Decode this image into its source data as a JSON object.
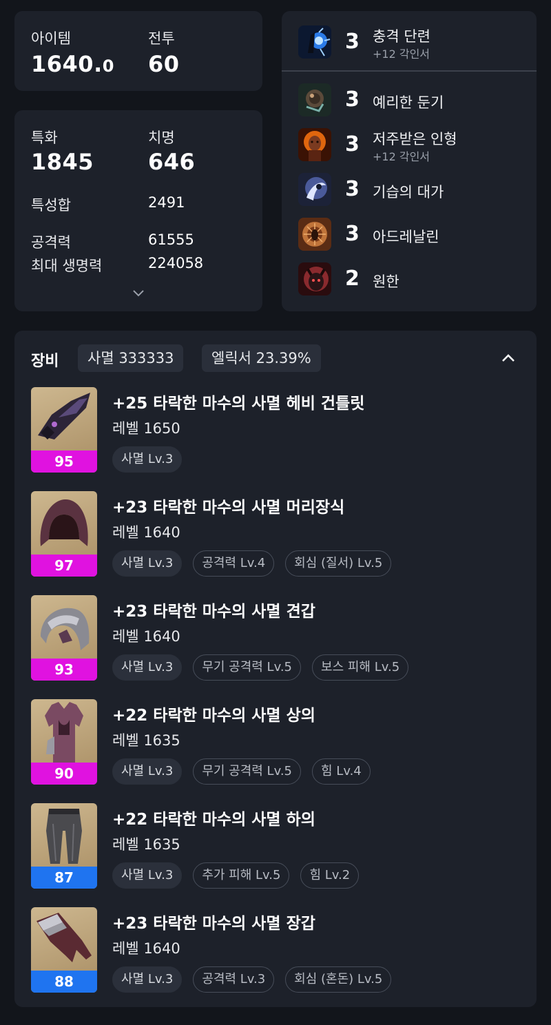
{
  "stats_top": {
    "item_label": "아이템",
    "item_value_main": "1640.",
    "item_value_decimal": "0",
    "combat_label": "전투",
    "combat_value": "60"
  },
  "stats_detail": {
    "spec_label": "특화",
    "spec_value": "1845",
    "crit_label": "치명",
    "crit_value": "646",
    "sum_label": "특성합",
    "sum_value": "2491",
    "atk_label": "공격력",
    "atk_value": "61555",
    "hp_label": "최대 생명력",
    "hp_value": "224058",
    "expand_icon": "chevron-down-icon"
  },
  "engravings": [
    {
      "level": "3",
      "name": "충격 단련",
      "sub": "+12 각인서",
      "icon": "shock-engraving-icon"
    },
    {
      "level": "3",
      "name": "예리한 둔기",
      "sub": "",
      "icon": "keen-blunt-engraving-icon"
    },
    {
      "level": "3",
      "name": "저주받은 인형",
      "sub": "+12 각인서",
      "icon": "cursed-doll-engraving-icon"
    },
    {
      "level": "3",
      "name": "기습의 대가",
      "sub": "",
      "icon": "master-ambush-engraving-icon"
    },
    {
      "level": "3",
      "name": "아드레날린",
      "sub": "",
      "icon": "adrenaline-engraving-icon"
    },
    {
      "level": "2",
      "name": "원한",
      "sub": "",
      "icon": "grudge-engraving-icon"
    }
  ],
  "equipment": {
    "title": "장비",
    "badge_set": "사멸 333333",
    "badge_elixir": "엘릭서 23.39%",
    "collapse_icon": "chevron-up-icon",
    "items": [
      {
        "name": "+25 타락한 마수의 사멸 헤비 건틀릿",
        "level": "레벨 1650",
        "quality": "95",
        "quality_color": "#e012e0",
        "icon": "gauntlet-icon",
        "tags": [
          "사멸 Lv.3"
        ]
      },
      {
        "name": "+23 타락한 마수의 사멸 머리장식",
        "level": "레벨 1640",
        "quality": "97",
        "quality_color": "#e012e0",
        "icon": "hood-icon",
        "tags": [
          "사멸 Lv.3",
          "공격력 Lv.4",
          "회심 (질서) Lv.5"
        ]
      },
      {
        "name": "+23 타락한 마수의 사멸 견갑",
        "level": "레벨 1640",
        "quality": "93",
        "quality_color": "#e012e0",
        "icon": "pauldron-icon",
        "tags": [
          "사멸 Lv.3",
          "무기 공격력 Lv.5",
          "보스 피해 Lv.5"
        ]
      },
      {
        "name": "+22 타락한 마수의 사멸 상의",
        "level": "레벨 1635",
        "quality": "90",
        "quality_color": "#e012e0",
        "icon": "chest-armor-icon",
        "tags": [
          "사멸 Lv.3",
          "무기 공격력 Lv.5",
          "힘 Lv.4"
        ]
      },
      {
        "name": "+22 타락한 마수의 사멸 하의",
        "level": "레벨 1635",
        "quality": "87",
        "quality_color": "#1f74f0",
        "icon": "leggings-icon",
        "tags": [
          "사멸 Lv.3",
          "추가 피해 Lv.5",
          "힘 Lv.2"
        ]
      },
      {
        "name": "+23 타락한 마수의 사멸 장갑",
        "level": "레벨 1640",
        "quality": "88",
        "quality_color": "#1f74f0",
        "icon": "glove-icon",
        "tags": [
          "사멸 Lv.3",
          "공격력 Lv.3",
          "회심 (혼돈) Lv.5"
        ]
      }
    ]
  }
}
